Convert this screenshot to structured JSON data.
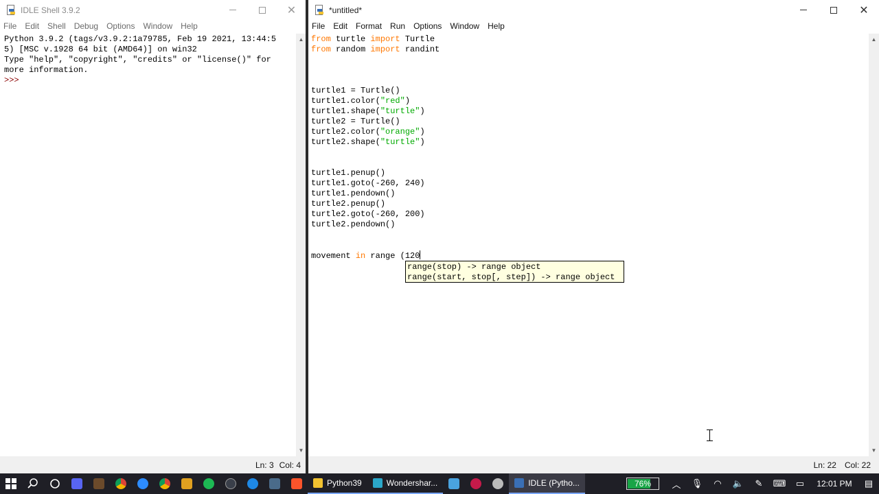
{
  "shell": {
    "title": "IDLE Shell 3.9.2",
    "menu": [
      "File",
      "Edit",
      "Shell",
      "Debug",
      "Options",
      "Window",
      "Help"
    ],
    "lines": [
      "Python 3.9.2 (tags/v3.9.2:1a79785, Feb 19 2021, 13:44:5",
      "5) [MSC v.1928 64 bit (AMD64)] on win32",
      "Type \"help\", \"copyright\", \"credits\" or \"license()\" for",
      "more information."
    ],
    "prompt": ">>>",
    "status": {
      "ln": "Ln: 3",
      "col": "Col: 4"
    }
  },
  "editor": {
    "title": "*untitled*",
    "menu": [
      "File",
      "Edit",
      "Format",
      "Run",
      "Options",
      "Window",
      "Help"
    ],
    "code": [
      [
        [
          "kw",
          "from"
        ],
        [
          "",
          " turtle "
        ],
        [
          "kw",
          "import"
        ],
        [
          "",
          " Turtle"
        ]
      ],
      [
        [
          "kw",
          "from"
        ],
        [
          "",
          " random "
        ],
        [
          "kw",
          "import"
        ],
        [
          "",
          " randint"
        ]
      ],
      [],
      [],
      [],
      [
        [
          "",
          "turtle1 = Turtle()"
        ]
      ],
      [
        [
          "",
          "turtle1.color("
        ],
        [
          "str",
          "\"red\""
        ],
        [
          "",
          ")"
        ]
      ],
      [
        [
          "",
          "turtle1.shape("
        ],
        [
          "str",
          "\"turtle\""
        ],
        [
          "",
          ")"
        ]
      ],
      [
        [
          "",
          "turtle2 = Turtle()"
        ]
      ],
      [
        [
          "",
          "turtle2.color("
        ],
        [
          "str",
          "\"orange\""
        ],
        [
          "",
          ")"
        ]
      ],
      [
        [
          "",
          "turtle2.shape("
        ],
        [
          "str",
          "\"turtle\""
        ],
        [
          "",
          ")"
        ]
      ],
      [],
      [],
      [
        [
          "",
          "turtle1.penup()"
        ]
      ],
      [
        [
          "",
          "turtle1.goto(-260, 240)"
        ]
      ],
      [
        [
          "",
          "turtle1.pendown()"
        ]
      ],
      [
        [
          "",
          "turtle2.penup()"
        ]
      ],
      [
        [
          "",
          "turtle2.goto(-260, 200)"
        ]
      ],
      [
        [
          "",
          "turtle2.pendown()"
        ]
      ],
      [],
      [],
      [
        [
          "",
          "movement "
        ],
        [
          "kw",
          "in"
        ],
        [
          "",
          " range (120"
        ]
      ]
    ],
    "calltip": [
      "range(stop) -> range object",
      "range(start, stop[, step]) -> range object"
    ],
    "status": {
      "ln": "Ln: 22",
      "col": "Col: 22"
    }
  },
  "taskbar": {
    "tasks": [
      {
        "label": "Python39",
        "icon": "folder-icon",
        "color": "#f2c230",
        "active": false
      },
      {
        "label": "Wondershar...",
        "icon": "filmora-icon",
        "color": "#2ba7c9",
        "active": false
      },
      {
        "label": "IDLE (Pytho...",
        "icon": "idle-icon",
        "color": "#3a6fb5",
        "active": true
      }
    ],
    "battery": {
      "label": "76%",
      "level": 0.76,
      "color": "#19a547"
    },
    "clock": "12:01 PM"
  },
  "colors": {
    "keyword": "#ff7700",
    "string": "#00aa00",
    "prompt": "#8b0000",
    "calltip_bg": "#ffffe0"
  }
}
